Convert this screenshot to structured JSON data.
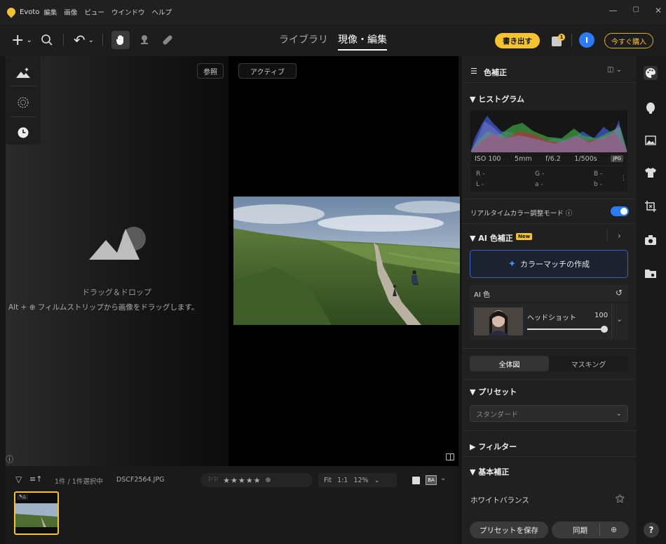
{
  "app": {
    "name": "Evoto",
    "menu": [
      "編集",
      "画像",
      "ビュー",
      "ウインドウ",
      "ヘルプ"
    ]
  },
  "toolbar": {
    "tabs": [
      "ライブラリ",
      "現像・編集"
    ],
    "export_label": "書き出す",
    "notify_count": "1",
    "avatar_letter": "I",
    "buy_label": "今すぐ購入"
  },
  "canvas": {
    "reference_label": "参照",
    "active_label": "アクティブ",
    "drop_title": "ドラッグ＆ドロップ",
    "drop_hint": "Alt +  ⊕ フィルムストリップから画像をドラッグします。"
  },
  "filmstrip": {
    "selection": "1件 / 1件選択中",
    "filename": "DSCF2564.JPG",
    "fit": "Fit",
    "ratio": "1:1",
    "zoom": "12%",
    "stars": "★★★★★",
    "ba": "BA"
  },
  "panel": {
    "title": "色補正",
    "histogram": {
      "label": "ヒストグラム",
      "iso": "ISO 100",
      "focal": "5mm",
      "aperture": "f/6.2",
      "shutter": "1/500s",
      "format": "JPG",
      "r": "R -",
      "g": "G -",
      "b": "B -",
      "l": "L -",
      "a": "a -",
      "b2": "b -"
    },
    "realtime_label": "リアルタイムカラー調整モード ⓘ",
    "ai_color": {
      "label": "AI 色補正",
      "badge": "New",
      "match_button": "カラーマッチの作成",
      "row_label": "AI 色",
      "preset_name": "ヘッドショット",
      "value": "100",
      "slider": 1.0
    },
    "segment": [
      "全体図",
      "マスキング"
    ],
    "presets": {
      "label": "プリセット",
      "selected": "スタンダード"
    },
    "filter_label": "フィルター",
    "basic": {
      "label": "基本補正",
      "wb_label": "ホワイトバランス"
    },
    "save_preset": "プリセットを保存",
    "sync": "同期"
  },
  "colors": {
    "accent": "#f4c430",
    "blue": "#2b7cf6"
  }
}
